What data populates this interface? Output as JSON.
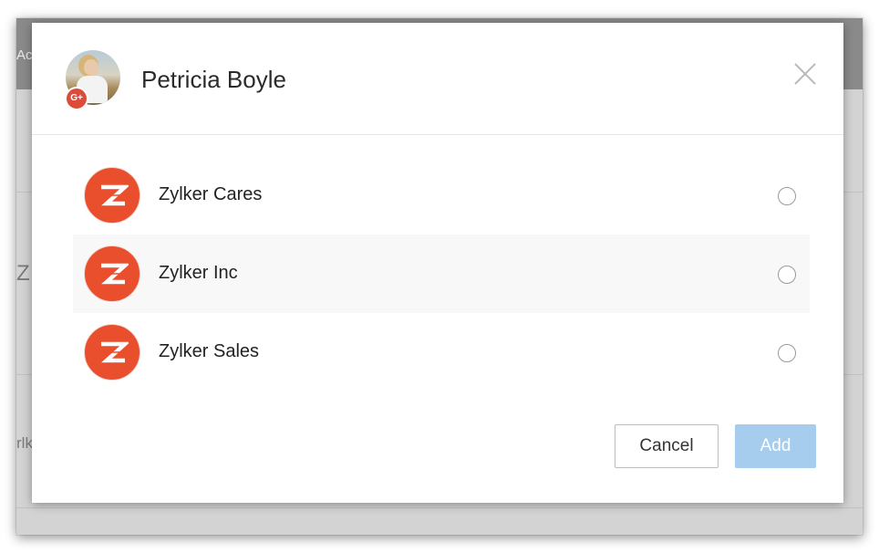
{
  "background": {
    "header_fragment": "Ac",
    "fragment_1": "Z",
    "fragment_2": "rlk"
  },
  "modal": {
    "profile": {
      "name": "Petricia Boyle",
      "badge_icon": "google-plus-icon",
      "badge_text": "G+"
    },
    "close_icon": "close-icon",
    "accounts": [
      {
        "name": "Zylker Cares",
        "logo_icon": "zylker-logo-icon",
        "selected": false
      },
      {
        "name": "Zylker Inc",
        "logo_icon": "zylker-logo-icon",
        "selected": false
      },
      {
        "name": "Zylker Sales",
        "logo_icon": "zylker-logo-icon",
        "selected": false
      }
    ],
    "buttons": {
      "cancel_label": "Cancel",
      "add_label": "Add"
    }
  },
  "colors": {
    "brand_orange": "#e94f2d",
    "add_button": "#a6cdee",
    "google_red": "#dd4b39"
  }
}
